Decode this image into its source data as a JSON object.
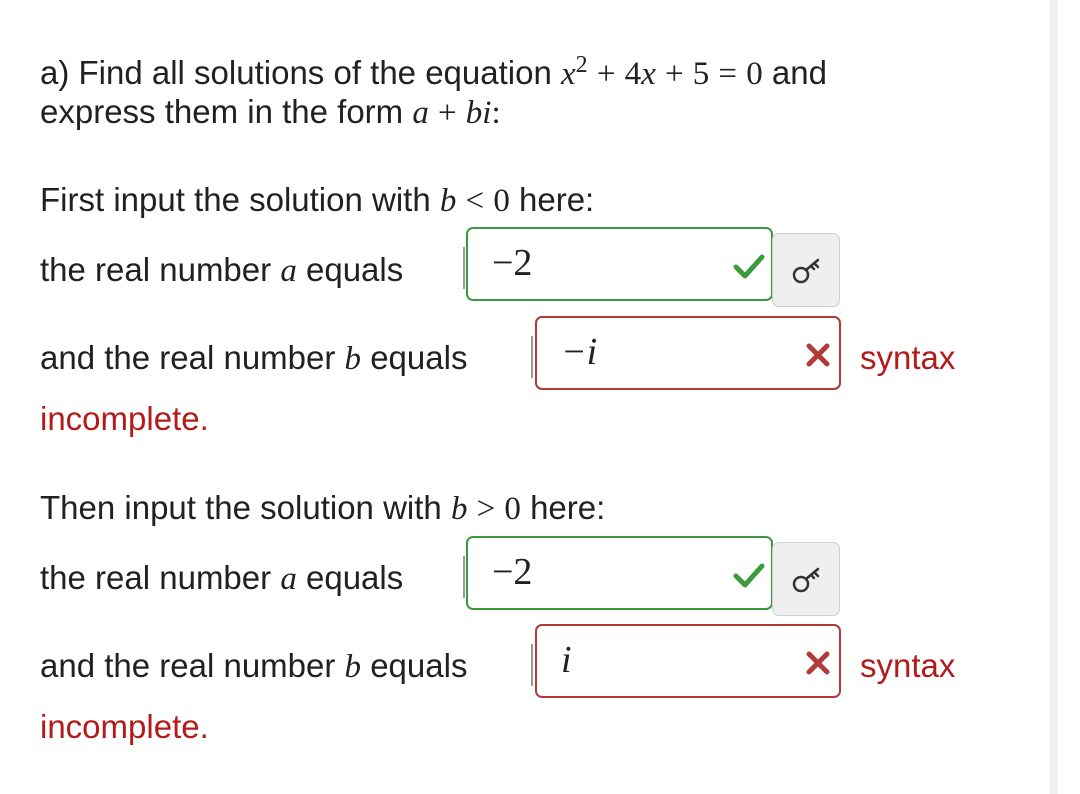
{
  "question": {
    "line1_prefix": "a) Find all solutions of the equation",
    "equation": {
      "x": "x",
      "exp": "2",
      "plus1": "+",
      "coef": "4",
      "x2": "x",
      "plus2": "+",
      "const": "5",
      "eq": "=",
      "rhs": "0"
    },
    "line1_suffix": "and",
    "line2_prefix": "express them in the form",
    "form": {
      "a": "a",
      "plus": "+",
      "b": "b",
      "i": "i",
      "colon": ":"
    }
  },
  "part1": {
    "intro_prefix": "First input the solution with",
    "intro_var": "b",
    "intro_op": "<",
    "intro_val": "0",
    "intro_suffix": "here:",
    "a_label_prefix": "the real number",
    "a_label_var": "a",
    "a_label_suffix": "equals",
    "a_value": "−2",
    "b_label_prefix": "and the real number",
    "b_label_var": "b",
    "b_label_suffix": "equals",
    "b_value": "−i",
    "b_status": "syntax",
    "feedback": "incomplete."
  },
  "part2": {
    "intro_prefix": "Then input the solution with",
    "intro_var": "b",
    "intro_op": ">",
    "intro_val": "0",
    "intro_suffix": "here:",
    "a_label_prefix": "the real number",
    "a_label_var": "a",
    "a_label_suffix": "equals",
    "a_value": "−2",
    "b_label_prefix": "and the real number",
    "b_label_var": "b",
    "b_label_suffix": "equals",
    "b_value": "i",
    "b_status": "syntax",
    "feedback": "incomplete."
  },
  "icons": {
    "correct": "check-icon",
    "incorrect": "cross-icon",
    "syntax_help": "key-icon"
  },
  "colors": {
    "correct": "#3c9a3c",
    "incorrect": "#b23a3a",
    "feedback_text": "#b31b1b"
  }
}
